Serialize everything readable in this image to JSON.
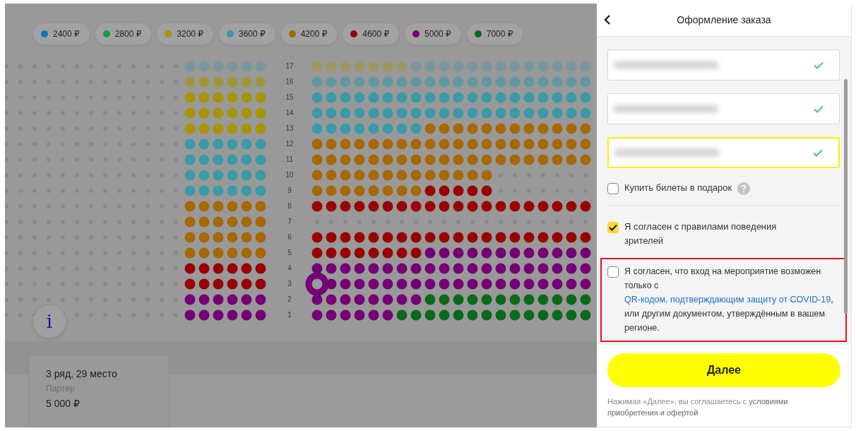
{
  "legend": [
    {
      "label": "2400 ₽",
      "color": "#1177b0"
    },
    {
      "label": "2800 ₽",
      "color": "#139a3a"
    },
    {
      "label": "3200 ₽",
      "color": "#a89400"
    },
    {
      "label": "3600 ₽",
      "color": "#3a9aa8"
    },
    {
      "label": "4200 ₽",
      "color": "#a86800"
    },
    {
      "label": "4600 ₽",
      "color": "#990000"
    },
    {
      "label": "5000 ₽",
      "color": "#750075"
    },
    {
      "label": "7000 ₽",
      "color": "#0a6a1a"
    }
  ],
  "seat_map": {
    "row_numbers": [
      "17",
      "16",
      "15",
      "14",
      "13",
      "12",
      "11",
      "10",
      "9",
      "8",
      "7",
      "6",
      "5",
      "4",
      "3",
      "2",
      "1"
    ]
  },
  "info_button": {
    "label": "i"
  },
  "selected_seat": {
    "title": "3 ряд, 29 место",
    "section": "Партер",
    "price": "5 000 ₽"
  },
  "panel": {
    "title": "Оформление заказа",
    "fields": [
      {
        "valid": true,
        "focused": false
      },
      {
        "valid": true,
        "focused": false
      },
      {
        "valid": true,
        "focused": true
      }
    ],
    "checkboxes": [
      {
        "label": "Купить билеты в подарок",
        "checked": false,
        "help": true,
        "highlighted": false
      },
      {
        "label": "Я согласен с правилами поведения зрителей",
        "checked": true,
        "help": false,
        "highlighted": false
      },
      {
        "label": "Я согласен, что вход на мероприятие возможен только с ",
        "link": "QR-кодом, подтверждающим защиту от COVID-19",
        "label_after": ", или другим документом, утверждённым в вашем регионе.",
        "checked": false,
        "help": false,
        "highlighted": true
      }
    ],
    "next_button": "Далее",
    "footer_note": "Нажимая «Далее», вы соглашаетесь с **условиями приобретения и офертой**"
  }
}
